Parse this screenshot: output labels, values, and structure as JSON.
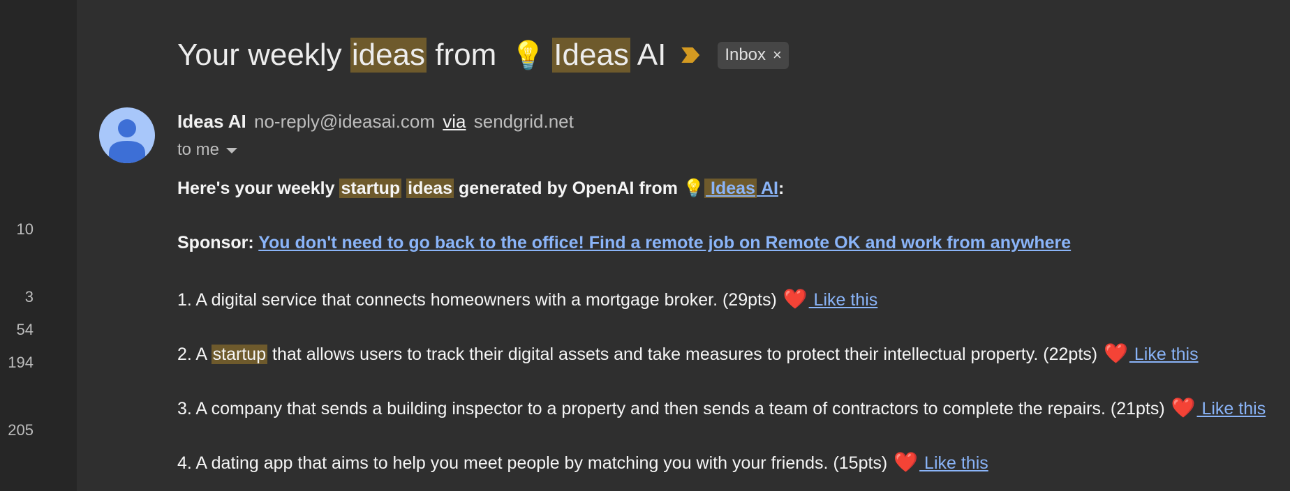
{
  "gutter_counts": [
    "10",
    "3",
    "54",
    "194",
    "205"
  ],
  "subject": {
    "part1": "Your weekly ",
    "hl1": "ideas",
    "part2": " from ",
    "bulb": "💡",
    "hl2": "Ideas",
    "part3": " AI"
  },
  "label_chip": {
    "text": "Inbox",
    "close": "×"
  },
  "sender": {
    "name": "Ideas AI",
    "email": "no-reply@ideasai.com",
    "via": "via",
    "via_domain": "sendgrid.net",
    "to": "to me"
  },
  "intro": {
    "t1": "Here's your weekly ",
    "hl1": "startup",
    "hl2": "ideas",
    "t2": " generated by OpenAI from ",
    "bulb": "💡",
    "link1": " Ideas",
    "link2": "AI",
    "t3": ":"
  },
  "sponsor": {
    "label": "Sponsor: ",
    "link": "You don't need to go back to the office! Find a remote job on Remote OK and work from anywhere"
  },
  "ideas": [
    {
      "text": "1. A digital service that connects homeowners with a mortgage broker. (29pts)",
      "heart": "❤️",
      "like": " Like this"
    },
    {
      "pre": "2. A ",
      "hl": "startup",
      "text": " that allows users to track their digital assets and take measures to protect their intellectual property. (22pts)",
      "heart": "❤️",
      "like": " Like this"
    },
    {
      "text": "3. A company that sends a building inspector to a property and then sends a team of contractors to complete the repairs. (21pts)",
      "heart": "❤️",
      "like": " Like this"
    },
    {
      "text": "4. A dating app that aims to help you meet people by matching you with your friends. (15pts)",
      "heart": "❤️",
      "like": " Like this"
    }
  ],
  "colors": {
    "link": "#8ab4f8",
    "highlight": "#6e5a2c",
    "importance_marker": "#d49a21",
    "background": "#2f2f2f"
  }
}
